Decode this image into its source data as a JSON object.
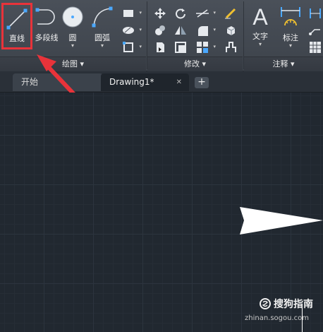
{
  "ribbon": {
    "draw_panel": {
      "line_label": "直线",
      "polyline_label": "多段线",
      "circle_label": "圆",
      "arc_label": "圆弧",
      "panel_title": "绘图"
    },
    "modify_panel": {
      "panel_title": "修改"
    },
    "annotation_panel": {
      "text_label": "文字",
      "dimension_label": "标注",
      "panel_title": "注释"
    },
    "dropdown_glyph": "▾"
  },
  "tabs": {
    "start_label": "开始",
    "drawing_label": "Drawing1*",
    "close_glyph": "✕",
    "new_tab_glyph": "+"
  },
  "watermark": {
    "name": "搜狗指南",
    "url": "zhinan.sogou.com"
  },
  "colors": {
    "highlight": "#e8333a",
    "canvas": "#212830",
    "ribbon": "#464c55"
  }
}
